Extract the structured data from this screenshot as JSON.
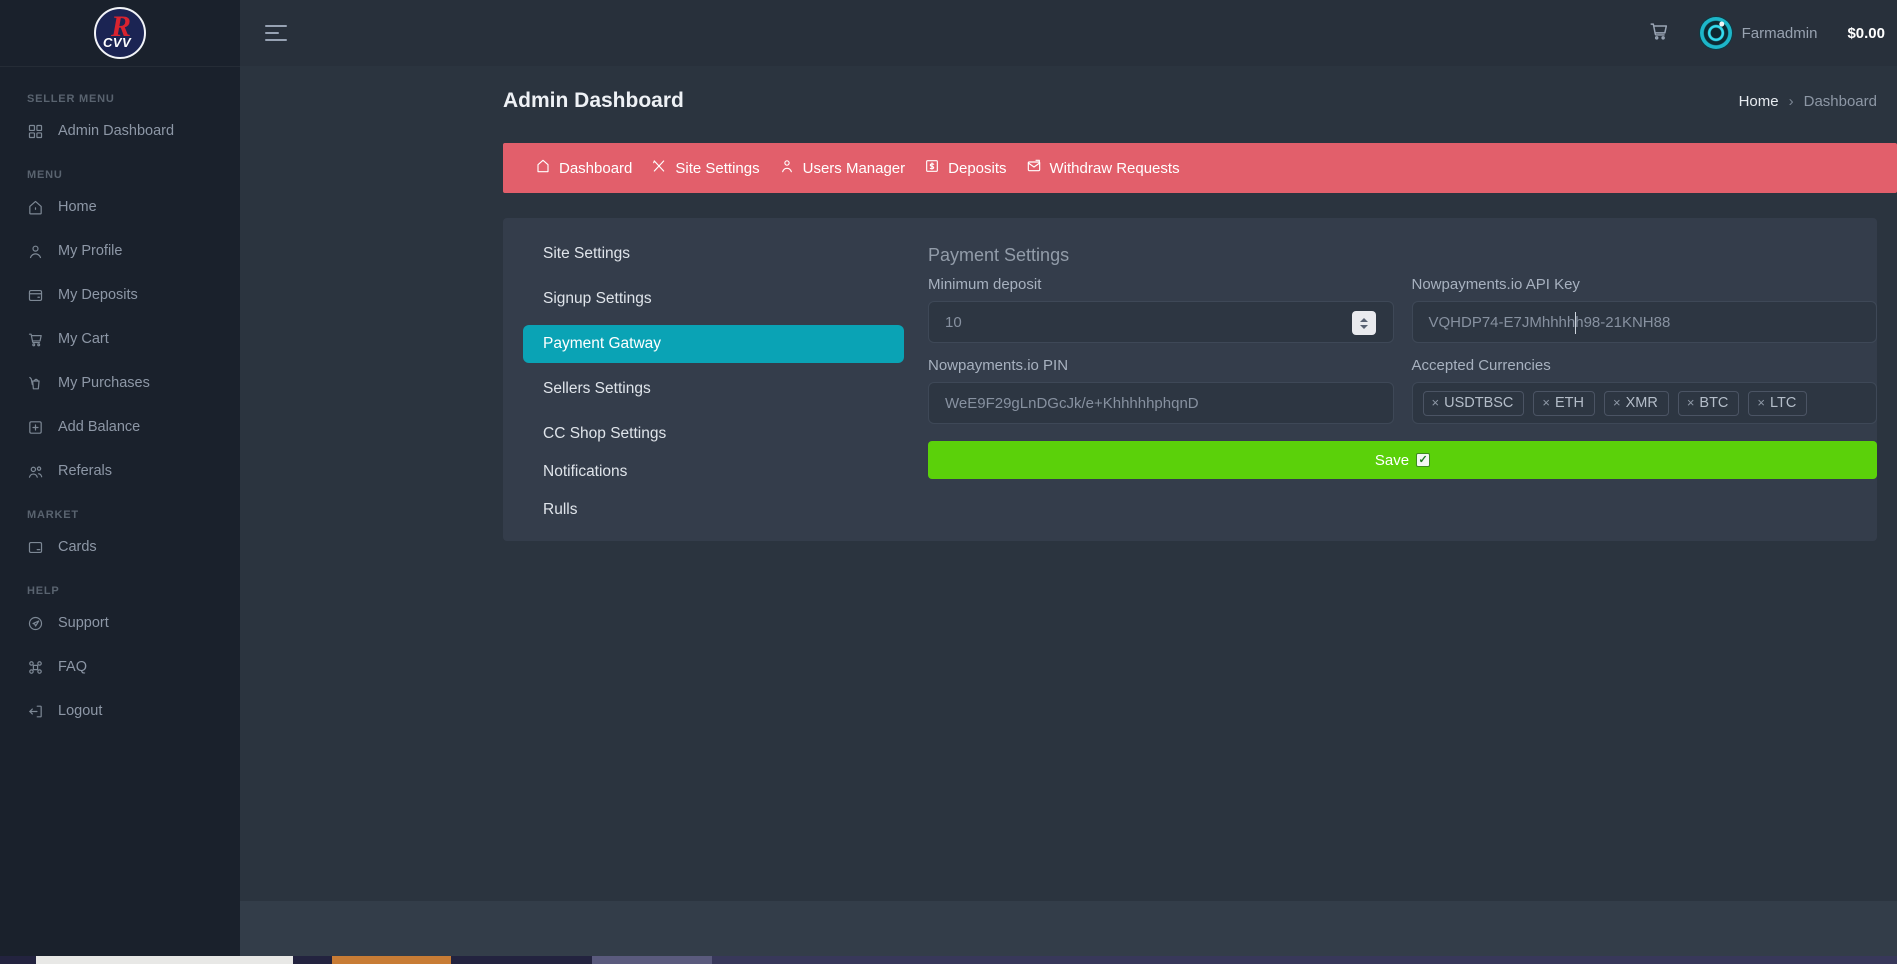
{
  "logo": {
    "letter": "R",
    "sub": "CVV"
  },
  "topbar": {
    "username": "Farmadmin",
    "balance": "$0.00"
  },
  "sidebar": {
    "sections": [
      {
        "label": "SELLER MENU",
        "items": [
          {
            "label": "Admin Dashboard",
            "icon": "dashboard-grid-icon"
          }
        ]
      },
      {
        "label": "MENU",
        "items": [
          {
            "label": "Home",
            "icon": "home-icon"
          },
          {
            "label": "My Profile",
            "icon": "profile-icon"
          },
          {
            "label": "My Deposits",
            "icon": "deposits-icon"
          },
          {
            "label": "My Cart",
            "icon": "cart-icon"
          },
          {
            "label": "My Purchases",
            "icon": "purchases-icon"
          },
          {
            "label": "Add Balance",
            "icon": "add-balance-icon"
          },
          {
            "label": "Referals",
            "icon": "referals-icon"
          }
        ]
      },
      {
        "label": "MARKET",
        "items": [
          {
            "label": "Cards",
            "icon": "cards-icon"
          }
        ]
      },
      {
        "label": "HELP",
        "items": [
          {
            "label": "Support",
            "icon": "support-icon"
          },
          {
            "label": "FAQ",
            "icon": "faq-icon"
          },
          {
            "label": "Logout",
            "icon": "logout-icon"
          }
        ]
      }
    ]
  },
  "header": {
    "title": "Admin Dashboard",
    "breadcrumb": {
      "home": "Home",
      "separator": "›",
      "current": "Dashboard"
    }
  },
  "admin_nav": {
    "items": [
      {
        "label": "Dashboard",
        "icon": "nav-home-icon"
      },
      {
        "label": "Site Settings",
        "icon": "nav-tools-icon"
      },
      {
        "label": "Users Manager",
        "icon": "nav-user-icon"
      },
      {
        "label": "Deposits",
        "icon": "nav-deposit-icon"
      },
      {
        "label": "Withdraw Requests",
        "icon": "nav-mail-icon"
      }
    ]
  },
  "settings_menu": {
    "items": [
      "Site Settings",
      "Signup Settings",
      "Payment Gatway",
      "Sellers Settings",
      "CC Shop Settings",
      "Notifications",
      "Rulls"
    ],
    "active": "Payment Gatway"
  },
  "form": {
    "section_title": "Payment Settings",
    "minimum_deposit": {
      "label": "Minimum deposit",
      "value": "10"
    },
    "api_key": {
      "label": "Nowpayments.io API Key",
      "value": "VQHDP74-E7JMhhhhh98-21KNH88"
    },
    "pin": {
      "label": "Nowpayments.io PIN",
      "value": "WeE9F29gLnDGcJk/e+KhhhhhphqnD"
    },
    "currencies": {
      "label": "Accepted Currencies",
      "remove_symbol": "×",
      "tags": [
        "USDTBSC",
        "ETH",
        "XMR",
        "BTC",
        "LTC"
      ]
    },
    "save_label": "Save",
    "check_glyph": "✓"
  },
  "colors": {
    "sidebar_bg": "#1a212c",
    "content_bg": "#2b343f",
    "card_bg": "#343d4b",
    "admin_nav_bg": "#e25f6b",
    "active_item": "#0aa3b5",
    "save_button": "#5bd10a"
  }
}
